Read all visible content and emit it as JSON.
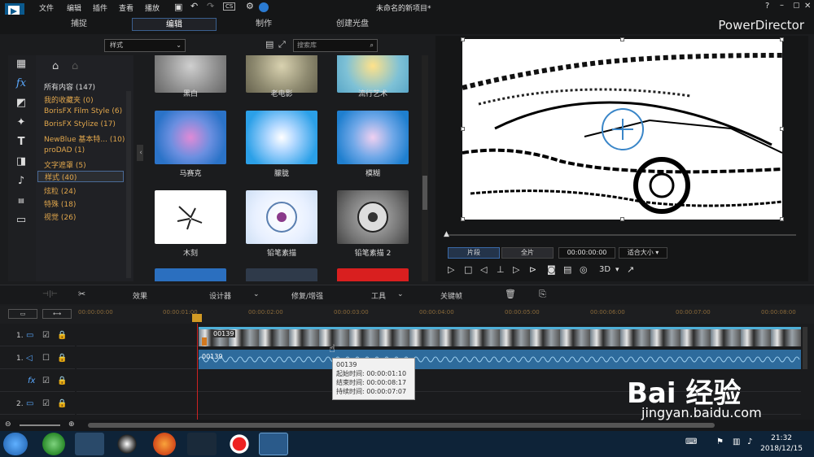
{
  "menu": {
    "items": [
      "文件",
      "编辑",
      "插件",
      "查看",
      "播放"
    ],
    "title": "未命名的新项目*",
    "zoom": "CS"
  },
  "modes": [
    "捕捉",
    "编辑",
    "制作",
    "创建光盘"
  ],
  "brand": "PowerDirector",
  "library": {
    "dropdown": "样式",
    "search_placeholder": "搜索库"
  },
  "categories": [
    {
      "label": "所有内容 (147)",
      "type": "all"
    },
    {
      "label": "我的收藏夹 (0)"
    },
    {
      "label": "BorisFX Film Style (6)"
    },
    {
      "label": "BorisFX Stylize (17)"
    },
    {
      "label": "NewBlue 基本特... (10)"
    },
    {
      "label": "proDAD (1)"
    },
    {
      "label": "文字遮罩 (5)"
    },
    {
      "label": "样式 (40)",
      "selected": true
    },
    {
      "label": "炫粒 (24)"
    },
    {
      "label": "特殊 (18)"
    },
    {
      "label": "视觉 (26)"
    }
  ],
  "effects": [
    {
      "label": "黑白"
    },
    {
      "label": "老电影"
    },
    {
      "label": "流行艺术"
    },
    {
      "label": "马赛克"
    },
    {
      "label": "朦胧"
    },
    {
      "label": "模糊"
    },
    {
      "label": "木刻"
    },
    {
      "label": "铅笔素描"
    },
    {
      "label": "铅笔素描 2"
    }
  ],
  "preview": {
    "clip_button": "片段",
    "full_button": "全片",
    "timecode": "00:00:00:00",
    "fit": "适合大小",
    "mode_3d": "3D"
  },
  "timeline_toolbar": {
    "effects": "效果",
    "designer": "设计器",
    "fix": "修复/增强",
    "tools": "工具",
    "keyframe": "关键帧"
  },
  "ruler": [
    "00:00:00:00",
    "00:00:01:00",
    "00:00:02:00",
    "00:00:03:00",
    "00:00:04:00",
    "00:00:05:00",
    "00:00:06:00",
    "00:00:07:00",
    "00:00:08:00"
  ],
  "tracks": [
    {
      "label": "1."
    },
    {
      "label": "1."
    },
    {
      "label": ""
    },
    {
      "label": "2."
    }
  ],
  "clip": {
    "video_name": "00139",
    "audio_name": "00139"
  },
  "tooltip": {
    "name": "00139",
    "start": "起始时间: 00:00:01:10",
    "end": "结束时间: 00:00:08:17",
    "duration": "持续时间:  00:00:07:07"
  },
  "taskbar": {
    "time": "21:32",
    "date": "2018/12/15"
  },
  "watermark": {
    "text": "Bai 经验",
    "url": "jingyan.baidu.com"
  }
}
